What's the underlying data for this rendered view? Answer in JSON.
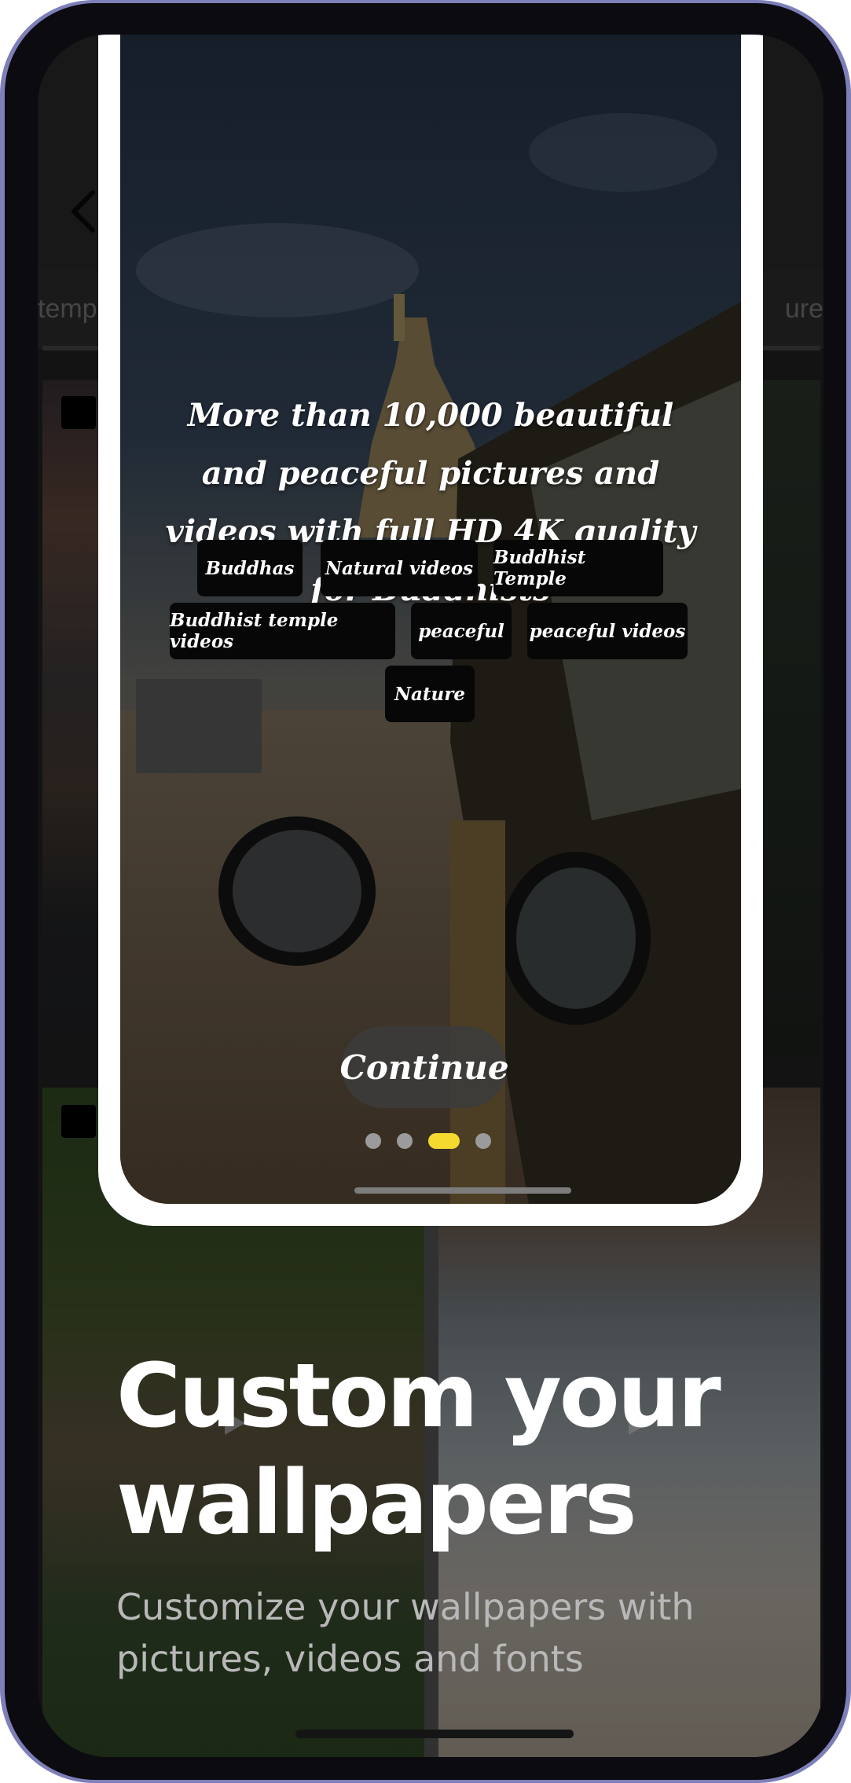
{
  "background_app": {
    "tab_left_label": "temp",
    "tab_right_label": "ure"
  },
  "onboarding_card": {
    "title": "More than 10,000 beautiful and peaceful pictures and videos with full HD 4K quality for Buddhists",
    "tags": [
      "Buddhas",
      "Natural videos",
      "Buddhist Temple",
      "Buddhist temple videos",
      "peaceful",
      "peaceful videos",
      "Nature"
    ],
    "continue_label": "Continue",
    "pagination": {
      "total": 4,
      "active_index": 3
    }
  },
  "hero": {
    "headline_line1": "Custom your",
    "headline_line2": "wallpapers",
    "subtext": "Customize your wallpapers with pictures, videos and fonts"
  },
  "colors": {
    "device_frame": "#7e7fb8",
    "active_dot": "#f5d92f",
    "chip_background": "#070707"
  },
  "icons": [
    "back-arrow-icon",
    "play-icon",
    "shield-icon"
  ]
}
